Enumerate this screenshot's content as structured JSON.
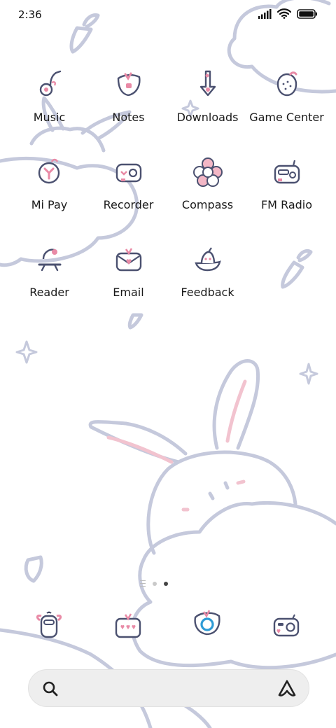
{
  "status_bar": {
    "time": "2:36",
    "icons": [
      "signal-icon",
      "wifi-icon",
      "battery-icon"
    ]
  },
  "apps": [
    {
      "label": "Music",
      "icon": "music-icon"
    },
    {
      "label": "Notes",
      "icon": "notes-icon"
    },
    {
      "label": "Downloads",
      "icon": "downloads-icon"
    },
    {
      "label": "Game Center",
      "icon": "game-center-icon"
    },
    {
      "label": "Mi Pay",
      "icon": "mi-pay-icon"
    },
    {
      "label": "Recorder",
      "icon": "recorder-icon"
    },
    {
      "label": "Compass",
      "icon": "compass-icon"
    },
    {
      "label": "FM Radio",
      "icon": "fm-radio-icon"
    },
    {
      "label": "Reader",
      "icon": "reader-icon"
    },
    {
      "label": "Email",
      "icon": "email-icon"
    },
    {
      "label": "Feedback",
      "icon": "feedback-icon"
    }
  ],
  "page_indicator": {
    "pages": 2,
    "current": 2
  },
  "dock": [
    {
      "icon": "phone-icon"
    },
    {
      "icon": "messages-icon"
    },
    {
      "icon": "browser-icon"
    },
    {
      "icon": "camera-icon"
    }
  ],
  "search": {
    "icons": [
      "search-icon",
      "assistant-icon"
    ]
  },
  "colors": {
    "line": "#c5c9dc",
    "line_dark": "#4b5170",
    "accent_pink": "#e98aa6",
    "accent_blue": "#2e9bd6"
  }
}
